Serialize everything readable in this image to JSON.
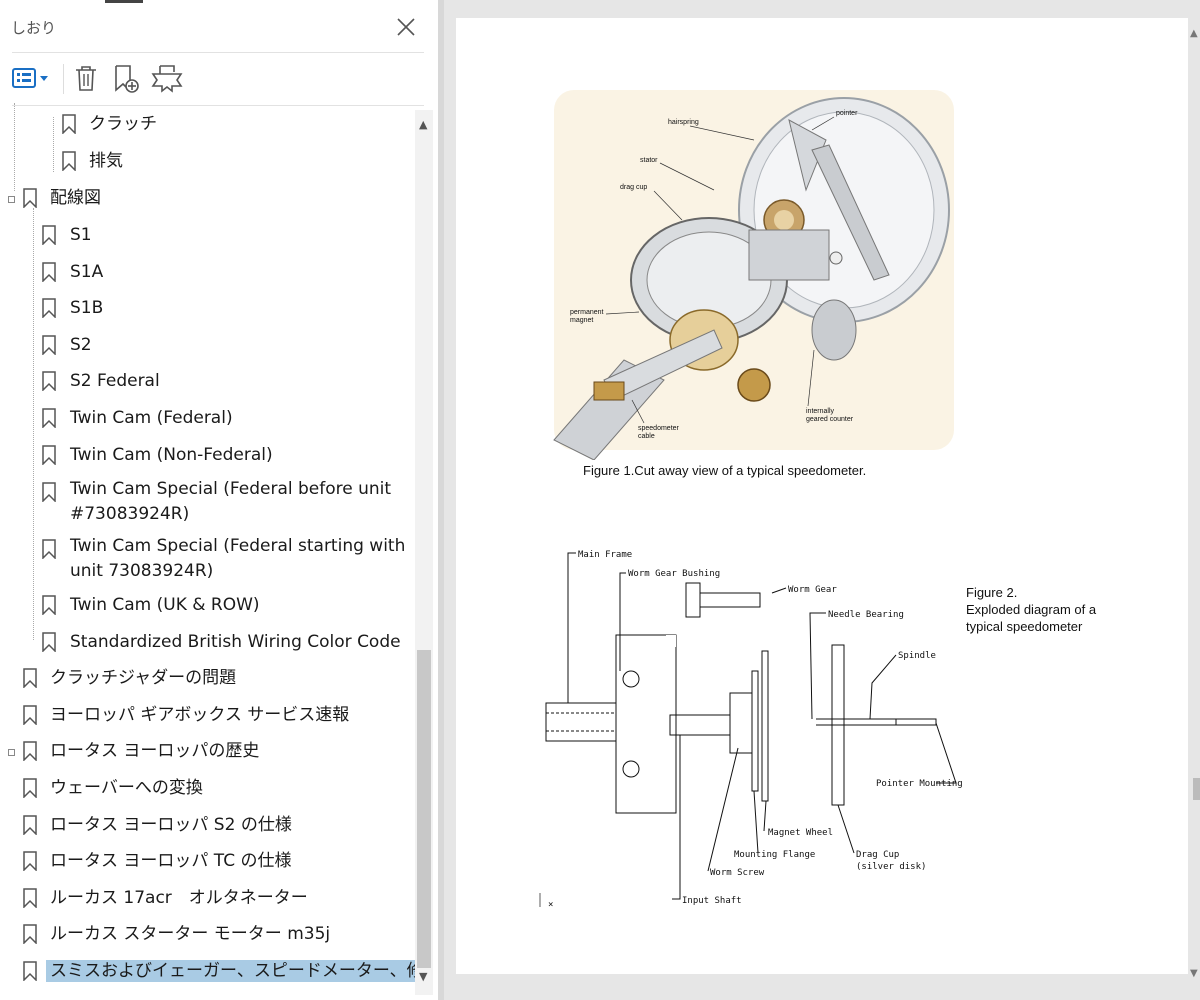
{
  "panel": {
    "title": "しおり",
    "toolbar": {
      "options_icon": "list-options-icon",
      "delete_icon": "trash-icon",
      "add_icon": "bookmark-add-icon",
      "tag_icon": "bookmark-tag-icon"
    }
  },
  "bookmarks": [
    {
      "label": "クラッチ"
    },
    {
      "label": "排気"
    },
    {
      "label": "配線図"
    },
    {
      "label": "S1"
    },
    {
      "label": "S1A"
    },
    {
      "label": "S1B"
    },
    {
      "label": "S2"
    },
    {
      "label": "S2 Federal"
    },
    {
      "label": "Twin Cam (Federal)"
    },
    {
      "label": "Twin Cam (Non-Federal)"
    },
    {
      "label": "Twin Cam Special (Federal before unit #73083924R)"
    },
    {
      "label": "Twin Cam Special (Federal starting with unit 73083924R)"
    },
    {
      "label": "Twin Cam (UK & ROW)"
    },
    {
      "label": "Standardized British Wiring Color Code"
    },
    {
      "label": "クラッチジャダーの問題"
    },
    {
      "label": "ヨーロッパ ギアボックス サービス速報"
    },
    {
      "label": "ロータス ヨーロッパの歴史"
    },
    {
      "label": "ウェーバーへの変換"
    },
    {
      "label": "ロータス ヨーロッパ S2 の仕様"
    },
    {
      "label": "ロータス ヨーロッパ TC の仕様"
    },
    {
      "label": "ルーカス 17acr　オルタネーター"
    },
    {
      "label": "ルーカス スターター モーター m35j"
    },
    {
      "label": "スミスおよびイェーガー、スピードメーター、修理"
    }
  ],
  "document": {
    "figure1_caption": "Figure 1.Cut away view of a typical speedometer.",
    "figure1_labels": {
      "hairspring": "hairspring",
      "pointer": "pointer",
      "stator": "stator",
      "drag_cup": "drag cup",
      "permanent": "permanent",
      "magnet": "magnet",
      "internally": "internally",
      "geared_counter": "geared counter",
      "speedometer": "speedometer",
      "cable": "cable"
    },
    "figure2_title": "Figure 2.",
    "figure2_sub1": "Exploded diagram of a",
    "figure2_sub2": "typical speedometer",
    "figure2_labels": {
      "main_frame": "Main Frame",
      "worm_gear_bushing": "Worm Gear Bushing",
      "worm_gear": "Worm Gear",
      "needle_bearing": "Needle Bearing",
      "spindle": "Spindle",
      "pointer_mounting": "Pointer Mounting",
      "magnet_wheel": "Magnet Wheel",
      "mounting_flange": "Mounting Flange",
      "worm_screw": "Worm Screw",
      "input_shaft": "Input Shaft",
      "drag_cup": "Drag Cup",
      "silver_disk": "(silver disk)"
    }
  },
  "colors": {
    "selection": "#a9cbe4",
    "accent_icon": "#1a6fc4"
  }
}
